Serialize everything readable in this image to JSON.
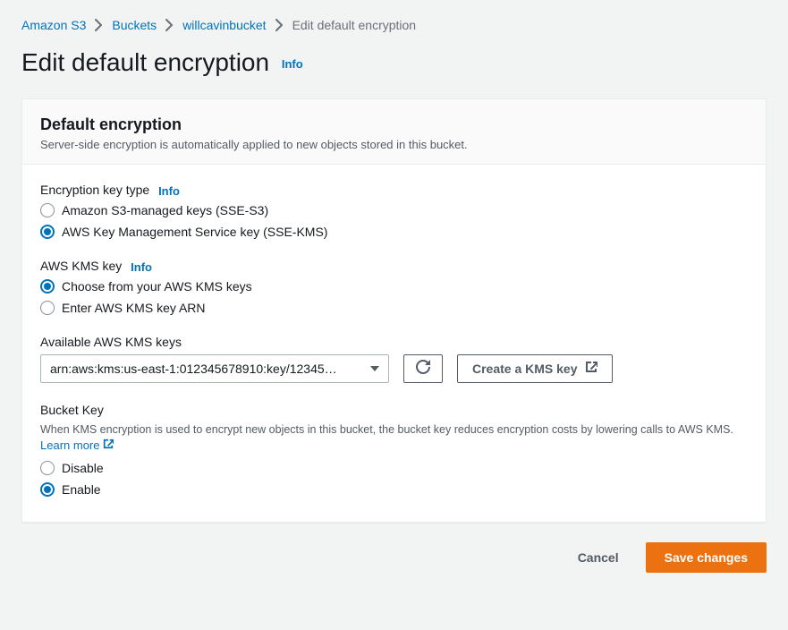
{
  "breadcrumb": {
    "items": [
      "Amazon S3",
      "Buckets",
      "willcavinbucket"
    ],
    "current": "Edit default encryption"
  },
  "page": {
    "title": "Edit default encryption",
    "info": "Info"
  },
  "card": {
    "title": "Default encryption",
    "subtitle": "Server-side encryption is automatically applied to new objects stored in this bucket."
  },
  "encryption_key_type": {
    "label": "Encryption key type",
    "info": "Info",
    "options": [
      {
        "label": "Amazon S3-managed keys (SSE-S3)",
        "checked": false
      },
      {
        "label": "AWS Key Management Service key (SSE-KMS)",
        "checked": true
      }
    ]
  },
  "kms_key": {
    "label": "AWS KMS key",
    "info": "Info",
    "options": [
      {
        "label": "Choose from your AWS KMS keys",
        "checked": true
      },
      {
        "label": "Enter AWS KMS key ARN",
        "checked": false
      }
    ]
  },
  "available_keys": {
    "label": "Available AWS KMS keys",
    "selected": "arn:aws:kms:us-east-1:012345678910:key/12345…",
    "create_label": "Create a KMS key"
  },
  "bucket_key": {
    "label": "Bucket Key",
    "description": "When KMS encryption is used to encrypt new objects in this bucket, the bucket key reduces encryption costs by lowering calls to AWS KMS.",
    "learn_more": "Learn more",
    "options": [
      {
        "label": "Disable",
        "checked": false
      },
      {
        "label": "Enable",
        "checked": true
      }
    ]
  },
  "actions": {
    "cancel": "Cancel",
    "save": "Save changes"
  }
}
